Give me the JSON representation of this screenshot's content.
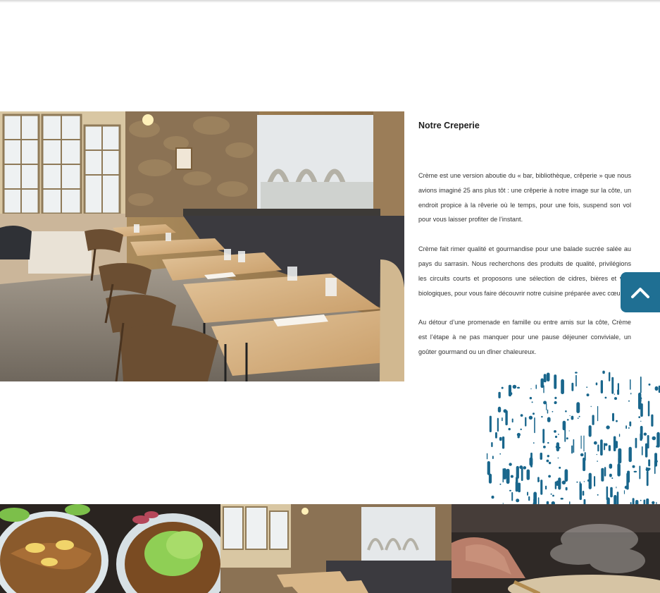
{
  "intro": {
    "title": "Notre Creperie",
    "paragraphs": [
      "Crème est une version aboutie du « bar, bibliothèque, crêperie » que nous avions imaginé 25 ans plus tôt : une crêperie à notre image sur la côte, un endroit propice à la rêverie où le temps, pour une fois, suspend son vol pour vous laisser profiter de l’instant.",
      "Crème fait rimer qualité et gourmandise pour une balade sucrée salée au pays du sarrasin. Nous recherchons des produits de qualité, privilégions les circuits courts et proposons une sélection de cidres, bières et vins biologiques, pour vous faire découvrir notre cuisine préparée avec cœur.",
      "Au détour d’une promenade en famille ou entre amis sur la côte, Crème est l’étape à ne pas manquer pour une pause déjeuner conviviale, un goûter gourmand ou un dîner chaleureux."
    ]
  },
  "scroll_top": {
    "icon": "chevron-up-icon"
  },
  "gallery": {
    "items": [
      {
        "subject": "galettes with salad"
      },
      {
        "subject": "restaurant dining room"
      },
      {
        "subject": "chef cooking crepe"
      }
    ]
  },
  "colors": {
    "accent": "#1f6f93",
    "splatter": "#19668c"
  }
}
